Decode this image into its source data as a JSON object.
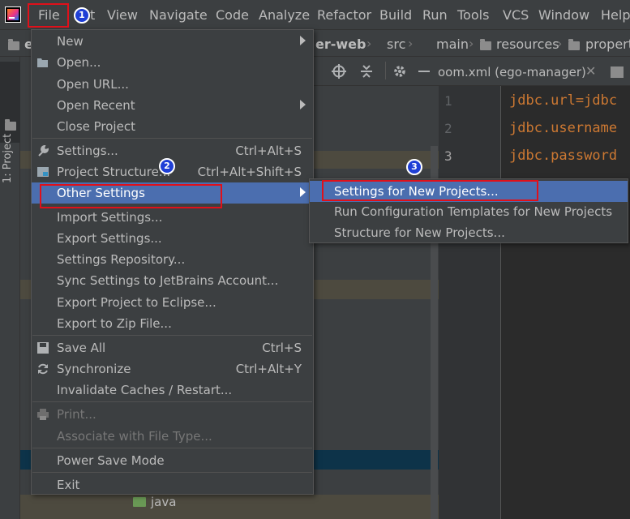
{
  "menubar": {
    "items": [
      "File",
      "Edit",
      "View",
      "Navigate",
      "Code",
      "Analyze",
      "Refactor",
      "Build",
      "Run",
      "Tools",
      "VCS",
      "Window",
      "Help"
    ],
    "visible_edit_fragment": "t"
  },
  "breadcrumb": {
    "project_fragment": "e",
    "module_fragment": "er-web",
    "items": [
      "src",
      "main",
      "resources",
      "propert"
    ]
  },
  "sidebar": {
    "project_tab": "1: Project"
  },
  "editor": {
    "tab_title": "pom.xml (ego-manager)",
    "visible_tab_text": "oom.xml (ego-manager)",
    "line_numbers": [
      "1",
      "2",
      "3"
    ],
    "lines": [
      "jdbc.url=jdbc",
      "jdbc.username",
      "jdbc.password"
    ]
  },
  "project_tree": {
    "java_folder": "java"
  },
  "file_menu": {
    "items": [
      {
        "label": "New",
        "submenu": true
      },
      {
        "label": "Open...",
        "icon": "folder-open-icon"
      },
      {
        "label": "Open URL..."
      },
      {
        "label": "Open Recent",
        "submenu": true
      },
      {
        "label": "Close Project"
      },
      {
        "label": "Settings...",
        "shortcut": "Ctrl+Alt+S",
        "icon": "wrench-icon"
      },
      {
        "label": "Project Structure...",
        "shortcut": "Ctrl+Alt+Shift+S",
        "icon": "project-structure-icon"
      },
      {
        "label": "Other Settings",
        "submenu": true,
        "selected": true
      },
      {
        "label": "Import Settings..."
      },
      {
        "label": "Export Settings..."
      },
      {
        "label": "Settings Repository..."
      },
      {
        "label": "Sync Settings to JetBrains Account..."
      },
      {
        "label": "Export Project to Eclipse..."
      },
      {
        "label": "Export to Zip File..."
      },
      {
        "label": "Save All",
        "shortcut": "Ctrl+S",
        "icon": "save-icon"
      },
      {
        "label": "Synchronize",
        "shortcut": "Ctrl+Alt+Y",
        "icon": "sync-icon"
      },
      {
        "label": "Invalidate Caches / Restart..."
      },
      {
        "label": "Print...",
        "disabled": true,
        "icon": "print-icon"
      },
      {
        "label": "Associate with File Type...",
        "disabled": true
      },
      {
        "label": "Power Save Mode"
      },
      {
        "label": "Exit"
      }
    ]
  },
  "other_settings_submenu": {
    "items": [
      {
        "label": "Settings for New Projects...",
        "selected": true
      },
      {
        "label": "Run Configuration Templates for New Projects"
      },
      {
        "label": "Structure for New Projects..."
      }
    ]
  },
  "annotations": {
    "badges": [
      "1",
      "2",
      "3"
    ],
    "color": "#e0101a"
  },
  "colors": {
    "selection": "#4b6eaf",
    "menu_bg": "#3c3f41",
    "editor_bg": "#2b2b2b",
    "keyword": "#cc7832"
  }
}
